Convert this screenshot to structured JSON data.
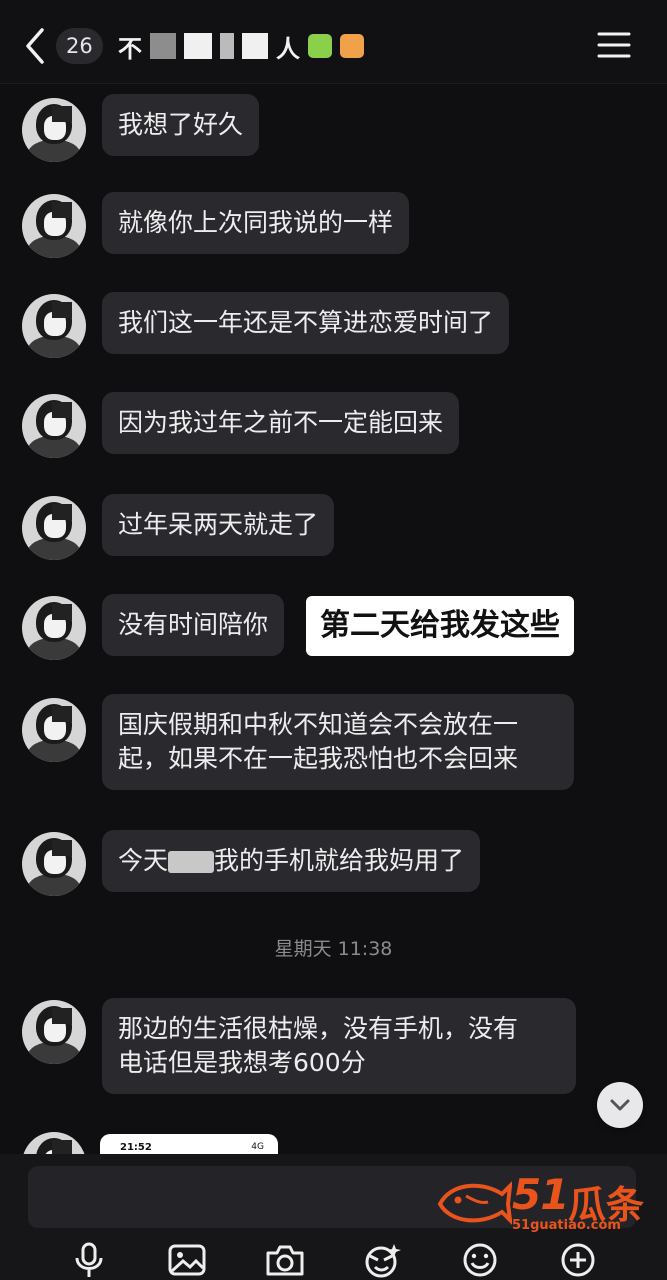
{
  "header": {
    "unread_count": "26",
    "title_visible_chars": "不",
    "title_fragment": "人"
  },
  "messages": [
    {
      "text": "我想了好久"
    },
    {
      "text": "就像你上次同我说的一样"
    },
    {
      "text": "我们这一年还是不算进恋爱时间了"
    },
    {
      "text": "因为我过年之前不一定能回来"
    },
    {
      "text": "过年呆两天就走了"
    },
    {
      "text": "没有时间陪你"
    },
    {
      "text_line1": "国庆假期和中秋不知道会不会放在一",
      "text_line2": "起，如果不在一起我恐怕也不会回来"
    },
    {
      "text_before": "今天",
      "text_after": "我的手机就给我妈用了"
    },
    {
      "text_line1": "那边的生活很枯燥，没有手机，没有",
      "text_line2": "电话但是我想考600分"
    }
  ],
  "annotation": "第二天给我发这些",
  "timestamp": "星期天 11:38",
  "thumbnail": {
    "time": "21:52",
    "status": "4G"
  },
  "watermark": {
    "number": "51",
    "name": "瓜条",
    "url": "51guatiao.com"
  },
  "colors": {
    "background": "#0f0f11",
    "bubble": "#2a2a2e",
    "accent": "#e8541c"
  }
}
